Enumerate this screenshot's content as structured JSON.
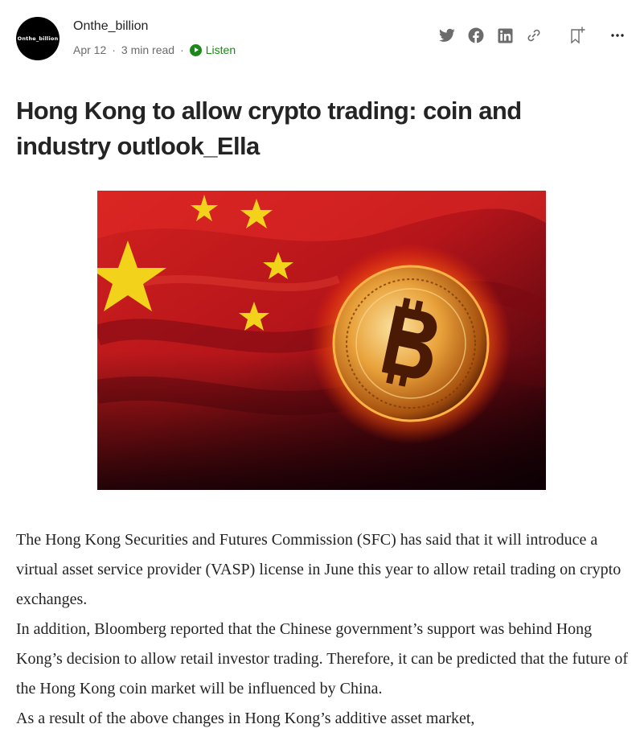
{
  "author": {
    "avatar_text": "Onthe_billion",
    "name": "Onthe_billion"
  },
  "meta": {
    "date": "Apr 12",
    "read_time": "3 min read",
    "separator": "·",
    "listen_label": "Listen"
  },
  "actions": [
    {
      "name": "twitter-share-icon"
    },
    {
      "name": "facebook-share-icon"
    },
    {
      "name": "linkedin-share-icon"
    },
    {
      "name": "copy-link-icon"
    },
    {
      "name": "bookmark-add-icon"
    },
    {
      "name": "more-options-icon"
    }
  ],
  "article": {
    "title": "Hong Kong to allow crypto trading: coin and industry outlook_Ella",
    "paragraphs": [
      "The Hong Kong Securities and Futures Commission (SFC) has said that it will introduce a virtual asset service provider (VASP) license in June this year to allow retail trading on crypto exchanges.",
      "In addition, Bloomberg reported that the Chinese government’s support was behind Hong Kong’s decision to allow retail investor trading. Therefore, it can be predicted that the future of the Hong Kong coin market will be influenced by China.",
      "As a result of the above changes in Hong Kong’s additive asset market,"
    ]
  },
  "colors": {
    "accent_green": "#1a8917",
    "text": "#242424",
    "muted": "#6b6b6b",
    "flag_red": "#c8181c",
    "star_yellow": "#f2d21b",
    "coin_gold": "#e9a23b"
  }
}
